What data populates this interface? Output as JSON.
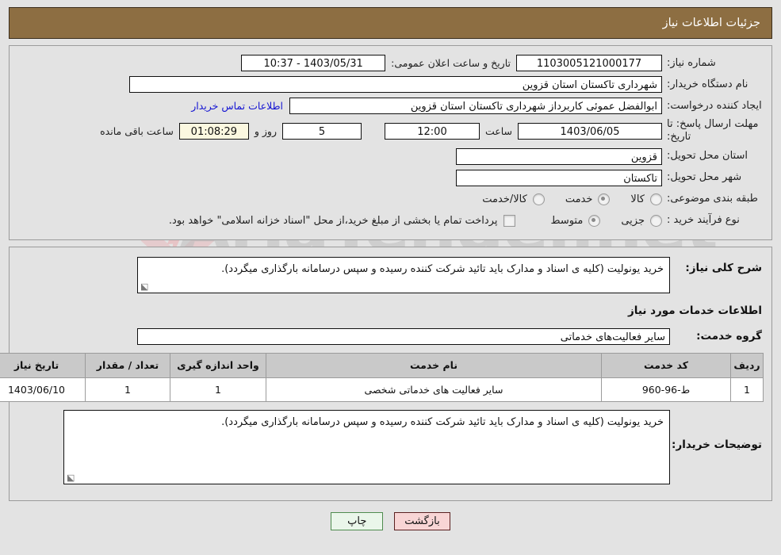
{
  "header": {
    "title": "جزئیات اطلاعات نیاز"
  },
  "watermark": {
    "text": "AriaTender.net"
  },
  "top_form": {
    "need_number_label": "شماره نیاز:",
    "need_number_value": "1103005121000177",
    "announce_label": "تاریخ و ساعت اعلان عمومی:",
    "announce_value": "1403/05/31 - 10:37",
    "buyer_org_label": "نام دستگاه خریدار:",
    "buyer_org_value": "شهرداری تاکستان استان قزوین",
    "creator_label": "ایجاد کننده درخواست:",
    "creator_value": "ابوالفضل عموئی کاربرداز شهرداری تاکستان استان قزوین",
    "contact_link": "اطلاعات تماس خریدار",
    "deadline_label": "مهلت ارسال پاسخ: تا تاریخ:",
    "deadline_value": "1403/06/05",
    "time_label": "ساعت",
    "time_value": "12:00",
    "days_value": "5",
    "days_label": "روز و",
    "timer_value": "01:08:29",
    "remaining_label": "ساعت باقی مانده",
    "province_label": "استان محل تحویل:",
    "province_value": "قزوین",
    "city_label": "شهر محل تحویل:",
    "city_value": "تاکستان",
    "category_label": "طبقه بندی موضوعی:",
    "category_options": [
      {
        "label": "کالا",
        "selected": false
      },
      {
        "label": "خدمت",
        "selected": true
      },
      {
        "label": "کالا/خدمت",
        "selected": false
      }
    ],
    "process_label": "نوع فرآیند خرید :",
    "process_options": [
      {
        "label": "جزیی",
        "selected": false
      },
      {
        "label": "متوسط",
        "selected": true
      }
    ],
    "treasury_checkbox_label": "پرداخت تمام یا بخشی از مبلغ خرید،از محل \"اسناد خزانه اسلامی\" خواهد بود.",
    "treasury_checked": false
  },
  "details": {
    "general_desc_label": "شرح کلی نیاز:",
    "general_desc_value": "خرید یونولیت (کلیه ی اسناد و مدارک باید تائید شرکت کننده رسیده و سپس درسامانه بارگذاری میگردد).",
    "services_heading": "اطلاعات خدمات مورد نیاز",
    "service_group_label": "گروه خدمت:",
    "service_group_value": "سایر فعالیت‌های خدماتی",
    "buyer_notes_label": "توضیحات خریدار:",
    "buyer_notes_value": "خرید یونولیت (کلیه ی اسناد و مدارک باید تائید شرکت کننده رسیده و سپس درسامانه بارگذاری میگردد)."
  },
  "items_table": {
    "columns": [
      "ردیف",
      "کد خدمت",
      "نام خدمت",
      "واحد اندازه گیری",
      "تعداد / مقدار",
      "تاریخ نیاز"
    ],
    "rows": [
      {
        "radif": "1",
        "code": "ط-96-960",
        "name": "سایر فعالیت های خدماتی شخصی",
        "unit": "1",
        "qty": "1",
        "date": "1403/06/10"
      }
    ]
  },
  "footer": {
    "print_label": "چاپ",
    "back_label": "بازگشت"
  }
}
